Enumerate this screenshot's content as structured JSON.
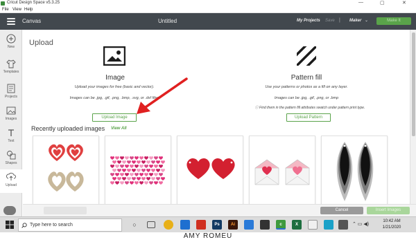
{
  "titlebar": {
    "title": "Cricut Design Space  v5.3.25",
    "minimize": "—",
    "maximize": "▢",
    "close": "✕"
  },
  "menubar": {
    "items": [
      "File",
      "View",
      "Help"
    ]
  },
  "header": {
    "canvas_label": "Canvas",
    "doc_title": "Untitled",
    "my_projects": "My Projects",
    "save": "Save",
    "separator": "|",
    "machine": "Maker",
    "chevron": "⌄",
    "make_it": "Make It"
  },
  "sidebar": {
    "items": [
      {
        "label": "New",
        "icon": "plus-circle-icon"
      },
      {
        "label": "Templates",
        "icon": "shirt-icon"
      },
      {
        "label": "Projects",
        "icon": "projects-icon"
      },
      {
        "label": "Images",
        "icon": "image-icon"
      },
      {
        "label": "Text",
        "icon": "text-icon"
      },
      {
        "label": "Shapes",
        "icon": "shapes-icon"
      },
      {
        "label": "Upload",
        "icon": "upload-icon"
      }
    ]
  },
  "main": {
    "title": "Upload",
    "image_option": {
      "title": "Image",
      "desc1": "Upload your images for free (basic and vector).",
      "desc2": "Images can be .jpg, .gif, .png, .bmp, .svg, or .dxf files",
      "button": "Upload Image"
    },
    "pattern_option": {
      "title": "Pattern fill",
      "desc1": "Use your patterns or photos as a fill on any layer.",
      "desc2": "Images can be .jpg, .gif, .png, or .bmp",
      "note": "ⓘ Find them in the pattern fill attributes swatch under pattern print type.",
      "button": "Upload Pattern"
    },
    "recent_title": "Recently uploaded images",
    "view_all": "View All"
  },
  "bottombar": {
    "cancel": "Cancel",
    "insert": "Insert Images"
  },
  "taskbar": {
    "search_placeholder": "Type here to search",
    "time": "10:42 AM",
    "date": "1/21/2020"
  },
  "watermark": "AMY ROMEU",
  "colors": {
    "header": "#42484e",
    "accent_green": "#5aa34a",
    "arrow_red": "#e02020"
  }
}
